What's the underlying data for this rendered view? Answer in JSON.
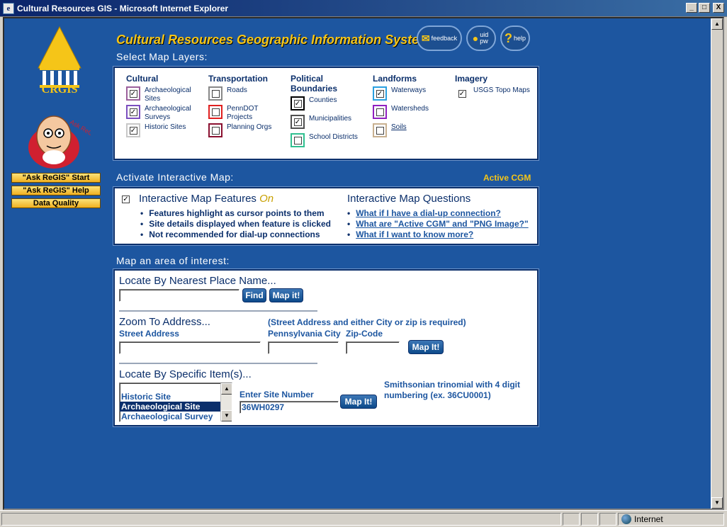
{
  "window": {
    "title": "Cultural Resources GIS - Microsoft Internet Explorer",
    "minimize": "_",
    "maximize": "□",
    "close": "X"
  },
  "status": {
    "zone": "Internet"
  },
  "sidebar": {
    "logo_text": "CRGIS",
    "mascot_label": "Ask ReGIS",
    "buttons": [
      "\"Ask ReGIS\" Start",
      "\"Ask ReGIS\" Help",
      "Data Quality"
    ]
  },
  "header": {
    "title": "Cultural Resources Geographic Information System",
    "feedback": "feedback",
    "uidpw": "uid pw",
    "help": "help"
  },
  "layers": {
    "heading": "Select Map Layers:",
    "columns": [
      {
        "title": "Cultural",
        "items": [
          {
            "label": "Archaeological Sites",
            "checked": true,
            "color": "#9b5f9b"
          },
          {
            "label": "Archaeological Surveys",
            "checked": true,
            "color": "#7b4fbf"
          },
          {
            "label": "Historic Sites",
            "checked": true,
            "color": "#c8c8c8"
          }
        ]
      },
      {
        "title": "Transportation",
        "items": [
          {
            "label": "Roads",
            "checked": false,
            "color": "#888888"
          },
          {
            "label": "PennDOT Projects",
            "checked": false,
            "color": "#e02020"
          },
          {
            "label": "Planning Orgs",
            "checked": false,
            "color": "#8a1030"
          }
        ]
      },
      {
        "title": "Political Boundaries",
        "items": [
          {
            "label": "Counties",
            "checked": true,
            "color": "#000000"
          },
          {
            "label": "Municipalities",
            "checked": true,
            "color": "#505050"
          },
          {
            "label": "School Districts",
            "checked": false,
            "color": "#30c090"
          }
        ]
      },
      {
        "title": "Landforms",
        "items": [
          {
            "label": "Waterways",
            "checked": true,
            "color": "#2aa0e0"
          },
          {
            "label": "Watersheds",
            "checked": false,
            "color": "#9020c0"
          },
          {
            "label": "Soils",
            "checked": false,
            "color": "#c8b090"
          }
        ]
      },
      {
        "title": "Imagery",
        "items": [
          {
            "label": "USGS Topo Maps",
            "checked": true,
            "color": "#ffffff"
          }
        ]
      }
    ]
  },
  "interactive": {
    "heading": "Activate Interactive Map:",
    "active_mode": "Active CGM",
    "features_title": "Interactive Map Features",
    "features_state": "On",
    "features": [
      "Features highlight as cursor points to them",
      "Site details displayed when feature is clicked",
      "Not recommended for dial-up connections"
    ],
    "questions_title": "Interactive Map Questions",
    "questions": [
      "What if I have a dial-up connection?",
      "What are \"Active CGM\" and \"PNG Image?\"",
      "What if I want to know more?"
    ]
  },
  "map_area": {
    "heading": "Map an area of interest:",
    "place_heading": "Locate By Nearest Place Name...",
    "place_value": "",
    "find_btn": "Find",
    "mapit_btn": "Map it!",
    "address_heading": "Zoom To Address...",
    "address_note": "(Street Address and either City or zip is required)",
    "street_label": "Street Address",
    "city_label": "Pennsylvania City",
    "zip_label": "Zip-Code",
    "mapit_btn2": "Map It!",
    "item_heading": "Locate By Specific Item(s)...",
    "item_options": [
      "Historic Site",
      "Archaeological Site",
      "Archaeological Survey"
    ],
    "selected_index": 1,
    "site_number_label": "Enter Site Number",
    "site_number_value": "36WH0297",
    "mapit_btn3": "Map It!",
    "site_note": "Smithsonian trinomial with 4 digit numbering (ex. 36CU0001)"
  }
}
